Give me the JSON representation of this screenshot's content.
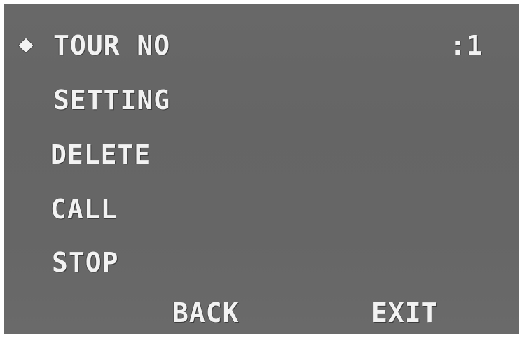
{
  "menu": {
    "cursor_icon": "diamond-cursor-icon",
    "items": [
      {
        "label": "TOUR NO",
        "value": ":1"
      },
      {
        "label": "SETTING"
      },
      {
        "label": "DELETE"
      },
      {
        "label": "CALL"
      },
      {
        "label": "STOP"
      }
    ]
  },
  "footer": {
    "back_label": "BACK",
    "exit_label": "EXIT"
  },
  "colors": {
    "background": "#666666",
    "text": "#f2f2f2"
  }
}
